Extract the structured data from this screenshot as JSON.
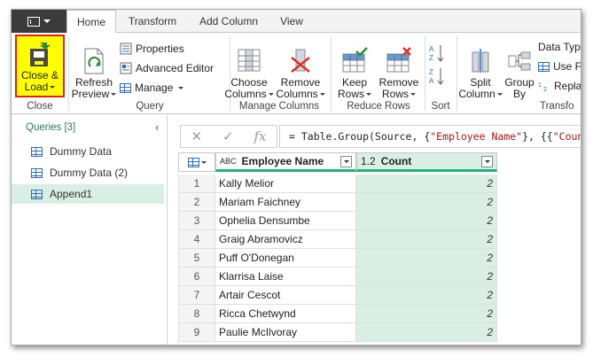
{
  "tabs": [
    "Home",
    "Transform",
    "Add Column",
    "View"
  ],
  "ribbon": {
    "close": {
      "line1": "Close &",
      "line2": "Load",
      "group": "Close"
    },
    "query": {
      "refresh1": "Refresh",
      "refresh2": "Preview",
      "properties": "Properties",
      "advanced_editor": "Advanced Editor",
      "manage": "Manage",
      "group": "Query"
    },
    "manage_columns": {
      "choose1": "Choose",
      "choose2": "Columns",
      "remove1": "Remove",
      "remove2": "Columns",
      "group": "Manage Columns"
    },
    "reduce_rows": {
      "keep1": "Keep",
      "keep2": "Rows",
      "remove1": "Remove",
      "remove2": "Rows",
      "group": "Reduce Rows"
    },
    "sort": {
      "group": "Sort"
    },
    "transform": {
      "split1": "Split",
      "split2": "Column",
      "group1": "Group",
      "group2": "By",
      "data_type": "Data Typ",
      "use_first": "Use F",
      "replace": "Repla",
      "group": "Transfo"
    }
  },
  "queries": {
    "header": "Queries [3]",
    "items": [
      "Dummy Data",
      "Dummy Data (2)",
      "Append1"
    ]
  },
  "formula_bar": {
    "prefix": "= Table.Group(Source, {",
    "str1": "\"Employee Name\"",
    "mid": "}, {{",
    "str2": "\"Count\""
  },
  "grid": {
    "columns": [
      {
        "type_icon": "ABC",
        "name": "Employee Name"
      },
      {
        "type_icon": "1.2",
        "name": "Count"
      }
    ],
    "rows": [
      {
        "n": "1",
        "name": "Kally Melior",
        "count": "2"
      },
      {
        "n": "2",
        "name": "Mariam Faichney",
        "count": "2"
      },
      {
        "n": "3",
        "name": "Ophelia Densumbe",
        "count": "2"
      },
      {
        "n": "4",
        "name": "Graig Abramovicz",
        "count": "2"
      },
      {
        "n": "5",
        "name": "Puff O'Donegan",
        "count": "2"
      },
      {
        "n": "6",
        "name": "Klarrisa Laise",
        "count": "2"
      },
      {
        "n": "7",
        "name": "Artair Cescot",
        "count": "2"
      },
      {
        "n": "8",
        "name": "Ricca Chetwynd",
        "count": "2"
      },
      {
        "n": "9",
        "name": "Paulie McIlvoray",
        "count": "2"
      }
    ]
  },
  "colors": {
    "accent": "#20b27d",
    "highlight": "#ffff00",
    "highlight_border": "#e0201c",
    "selected_bg": "#d9efe3"
  }
}
